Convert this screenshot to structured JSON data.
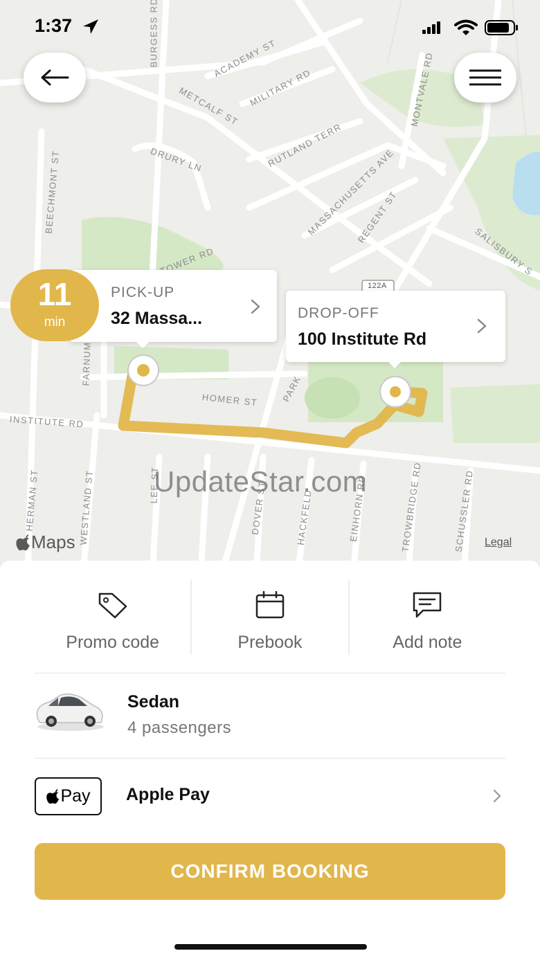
{
  "status_bar": {
    "time": "1:37",
    "icons": [
      "location-arrow-icon",
      "cellular-signal-icon",
      "wifi-icon",
      "battery-icon"
    ]
  },
  "map": {
    "streets": [
      "BURGESS RD",
      "ACADEMY ST",
      "METCALF ST",
      "MILITARY RD",
      "MONTVALE RD",
      "DRURY LN",
      "RUTLAND TERR",
      "BEECHMONT ST",
      "MASSACHUSETTS AVE",
      "REGENT ST",
      "SALISBURY S",
      "TOWER RD",
      "FARNUM",
      "HOMER ST",
      "INSTITUTE RD",
      "PARK",
      "122A",
      "HERMAN ST",
      "WESTLAND ST",
      "LEE ST",
      "DOVER ST",
      "HACKFELD",
      "EINHORN RD",
      "TROWBRIDGE RD",
      "SCHUSSLER RD"
    ],
    "watermark": "UpdateStar.com",
    "maps_brand": "Maps",
    "legal": "Legal",
    "route_color": "#e1b64b"
  },
  "eta": {
    "value": "11",
    "unit": "min"
  },
  "pickup": {
    "label": "PICK-UP",
    "address": "32 Massa..."
  },
  "dropoff": {
    "label": "DROP-OFF",
    "address": "100 Institute Rd"
  },
  "actions": [
    {
      "label": "Promo code",
      "icon": "tag-icon"
    },
    {
      "label": "Prebook",
      "icon": "calendar-icon"
    },
    {
      "label": "Add note",
      "icon": "note-icon"
    }
  ],
  "vehicle": {
    "name": "Sedan",
    "capacity": "4 passengers",
    "icon": "sedan-car-icon"
  },
  "payment": {
    "badge": "Pay",
    "method": "Apple Pay"
  },
  "confirm_label": "CONFIRM BOOKING",
  "colors": {
    "accent": "#e1b64b",
    "map_background": "#eeeeea",
    "park_green": "#d5e8c6",
    "water": "#b9def0"
  }
}
